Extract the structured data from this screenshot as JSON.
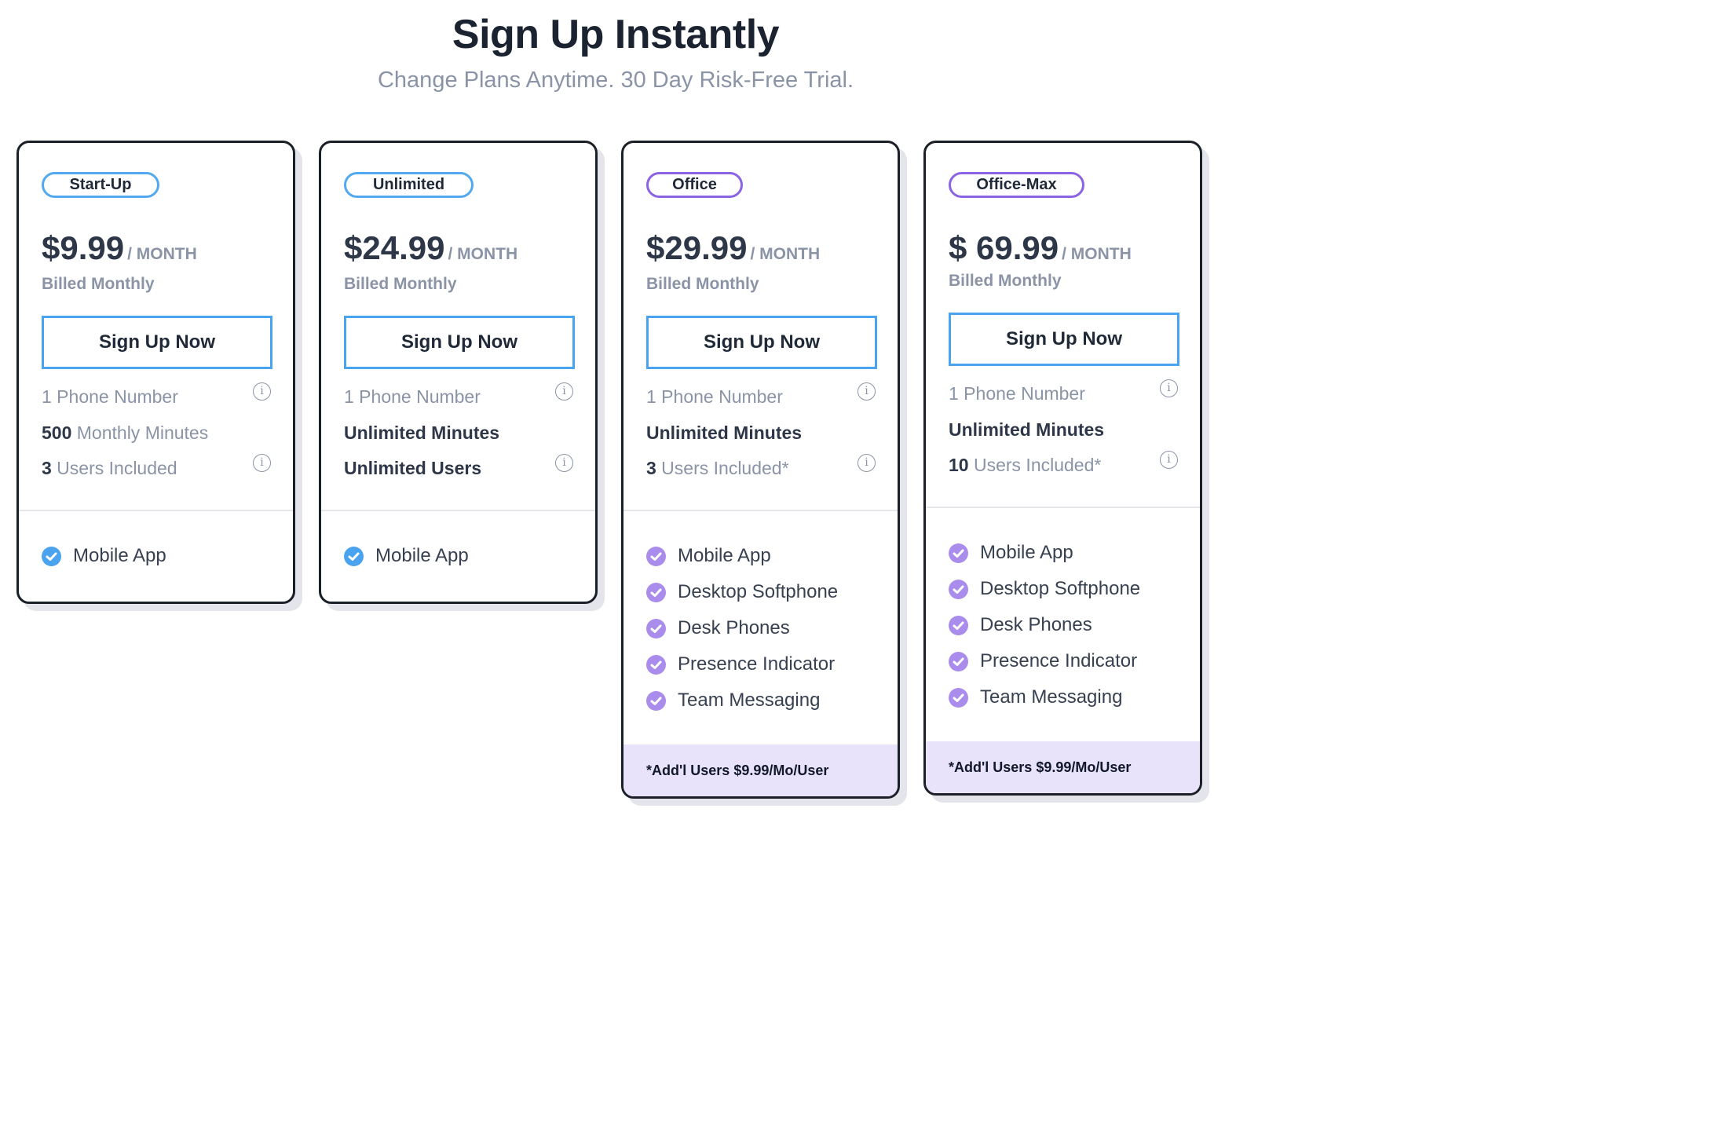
{
  "header": {
    "title": "Sign Up Instantly",
    "subtitle": "Change Plans Anytime. 30 Day Risk-Free Trial."
  },
  "colors": {
    "blue_accent": "#4aa3ef",
    "purple_accent": "#8b63e3",
    "blue_check": "#4aa3ef",
    "purple_check": "#a98ceb",
    "note_bg": "#e8e3fb"
  },
  "plans": [
    {
      "name": "Start-Up",
      "price": "$9.99",
      "period": "/ MONTH",
      "billing": "Billed Monthly",
      "cta": "Sign Up Now",
      "phone": "1 Phone Number",
      "minutes_value": "500",
      "minutes_label": " Monthly Minutes",
      "users_value": "3",
      "users_label": " Users Included",
      "features": [
        "Mobile App"
      ]
    },
    {
      "name": "Unlimited",
      "price": "$24.99",
      "period": "/ MONTH",
      "billing": "Billed Monthly",
      "cta": "Sign Up Now",
      "phone": "1 Phone Number",
      "minutes": "Unlimited Minutes",
      "users": "Unlimited Users",
      "features": [
        "Mobile App"
      ]
    },
    {
      "name": "Office",
      "price": "$29.99",
      "period": "/ MONTH",
      "billing": "Billed Monthly",
      "cta": "Sign Up Now",
      "phone": "1 Phone Number",
      "minutes": "Unlimited Minutes",
      "users_value": "3",
      "users_label": " Users Included*",
      "features": [
        "Mobile App",
        "Desktop Softphone",
        "Desk Phones",
        "Presence Indicator",
        "Team Messaging"
      ],
      "note": "*Add'l Users $9.99/Mo/User"
    },
    {
      "name": "Office-Max",
      "price": "$ 69.99",
      "period": "/ MONTH",
      "billing": "Billed Monthly",
      "cta": "Sign Up Now",
      "phone": "1 Phone Number",
      "minutes": "Unlimited Minutes",
      "users_value": "10",
      "users_label": " Users Included*",
      "features": [
        "Mobile App",
        "Desktop Softphone",
        "Desk Phones",
        "Presence Indicator",
        "Team Messaging"
      ],
      "note": "*Add'l Users $9.99/Mo/User"
    }
  ],
  "icons": {
    "info": "info-circle-icon",
    "check": "check-circle-icon"
  }
}
